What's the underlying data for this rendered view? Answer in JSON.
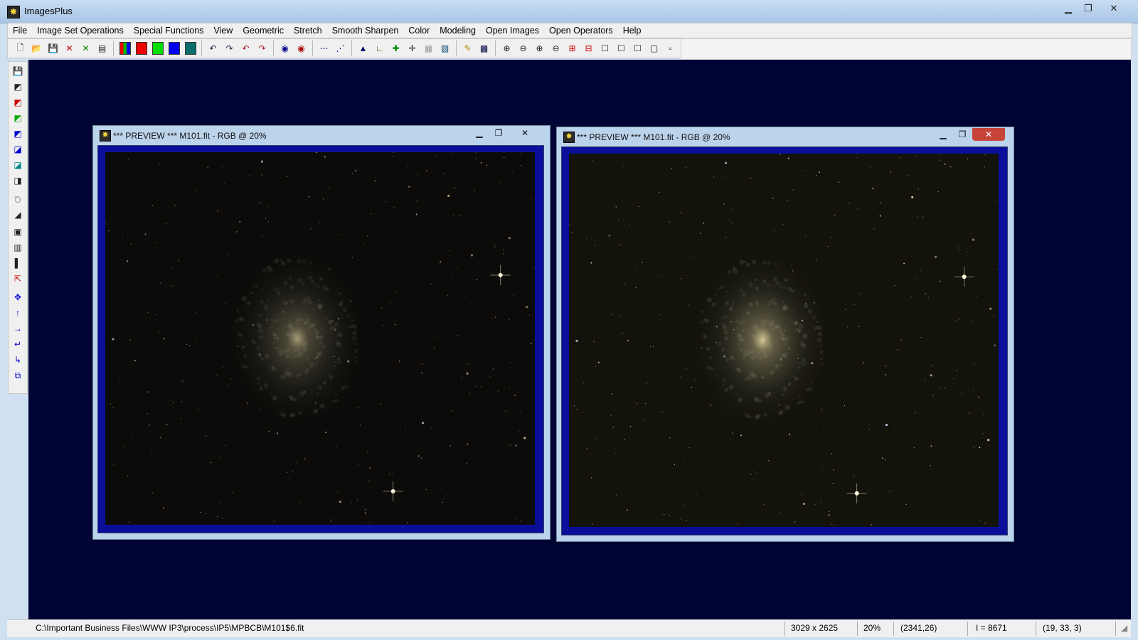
{
  "app": {
    "title": "ImagesPlus"
  },
  "menu": [
    "File",
    "Image Set Operations",
    "Special Functions",
    "View",
    "Geometric",
    "Stretch",
    "Smooth Sharpen",
    "Color",
    "Modeling",
    "Open Images",
    "Open Operators",
    "Help"
  ],
  "colors": {
    "workspace": "#000434",
    "frame": "#08109a",
    "swatch_rgb": "#d33",
    "swatch_red": "#ee0000",
    "swatch_green": "#00dd00",
    "swatch_blue": "#0000ee"
  },
  "windows": [
    {
      "title": "*** PREVIEW *** M101.fit - RGB @ 20%"
    },
    {
      "title": "*** PREVIEW *** M101.fit - RGB @ 20%"
    }
  ],
  "status": {
    "path": "C:\\Important Business Files\\WWW IP3\\process\\IP5\\MPBCB\\M101$6.fit",
    "dimensions": "3029 x 2625",
    "zoom": "20%",
    "coords": "(2341,26)",
    "intensity": "I = 8671",
    "rgb": "(19, 33, 3)"
  }
}
